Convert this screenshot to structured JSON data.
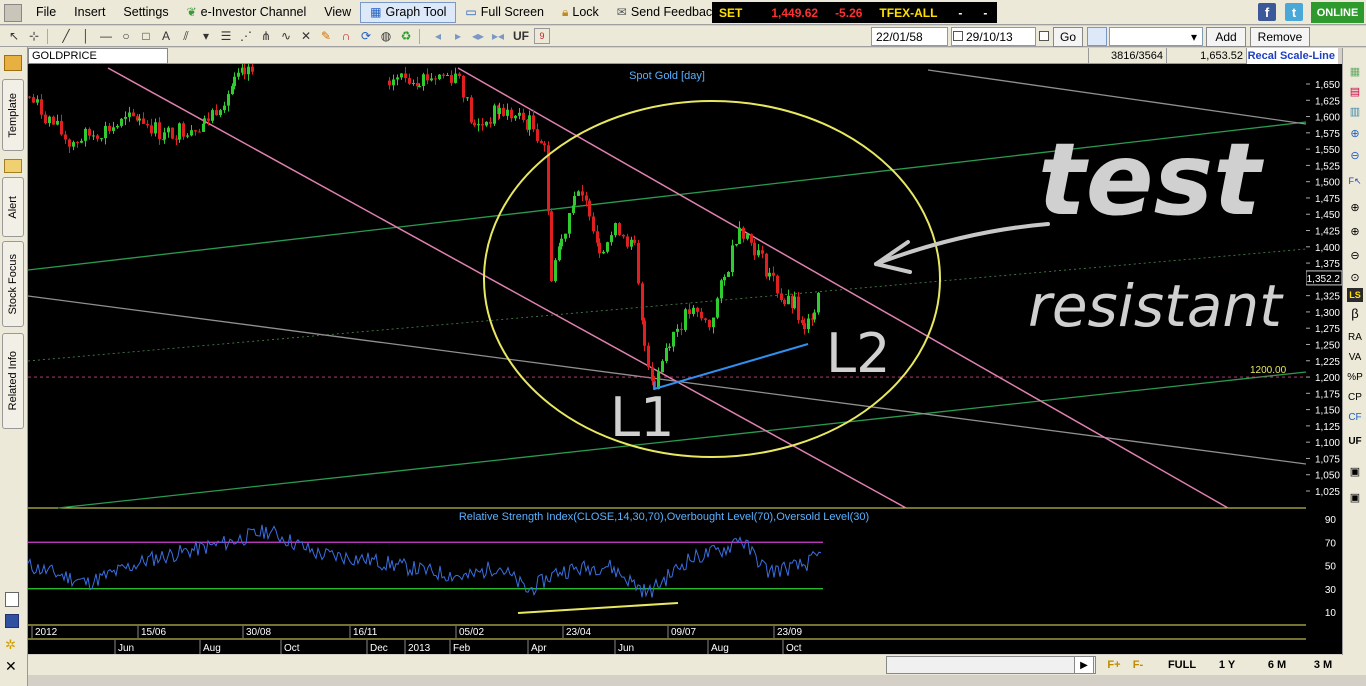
{
  "menu": {
    "items": [
      {
        "label": "File"
      },
      {
        "label": "Insert"
      },
      {
        "label": "Settings"
      },
      {
        "label": "e-Investor Channel",
        "icon": "leaf-icon"
      },
      {
        "label": "View"
      },
      {
        "label": "Graph Tool",
        "icon": "graph-icon"
      },
      {
        "label": "Full Screen",
        "icon": "fullscreen-icon"
      },
      {
        "label": "Lock",
        "icon": "lock-icon"
      },
      {
        "label": "Send Feedback",
        "icon": "feedback-icon"
      }
    ]
  },
  "ticker": {
    "set_label": "SET",
    "set_value": "1,449.62",
    "set_change": "-5.26",
    "tfex_label": "TFEX-ALL",
    "tfex_value": "-",
    "tfex_change": "-"
  },
  "status": {
    "online": "ONLINE"
  },
  "toolbar": {
    "uf_label": "UF",
    "cal_label": "9",
    "date_from": "22/01/58",
    "date_to": "29/10/13",
    "go_label": "Go",
    "add_label": "Add",
    "remove_label": "Remove"
  },
  "left_tabs": [
    "Template",
    "Alert",
    "Stock Focus",
    "Related Info"
  ],
  "symbol": "GOLDPRICE",
  "infobar": {
    "count": "3816/3564",
    "value": "1,653.52",
    "scale": "Recal Scale-Line"
  },
  "right_strip": [
    "LS",
    "β",
    "RA",
    "VA",
    "%P",
    "CP",
    "CF",
    "UF"
  ],
  "chart_data": {
    "type": "candlestick",
    "title": "Spot Gold [day]",
    "ylim": [
      1000,
      1665
    ],
    "yticks": [
      1650,
      1625,
      1600,
      1575,
      1550,
      1525,
      1500,
      1475,
      1450,
      1425,
      1400,
      1375,
      1350,
      1325,
      1300,
      1275,
      1250,
      1225,
      1200,
      1175,
      1150,
      1125,
      1100,
      1075,
      1050,
      1025
    ],
    "last_price": "1,352.2",
    "hline_label": "1200.00",
    "annotations": [
      "test",
      "resistant",
      "L1",
      "L2"
    ],
    "rsi": {
      "title": "Relative Strength Index(CLOSE,14,30,70),Overbought Level(70),Oversold Level(30)",
      "yticks": [
        90,
        70,
        50,
        30,
        10
      ],
      "overbought": 70,
      "oversold": 30
    },
    "dates_top": [
      "2012",
      "15/06",
      "30/08",
      "16/11",
      "05/02",
      "23/04",
      "09/07",
      "23/09"
    ],
    "dates_bottom": [
      "Jun",
      "Aug",
      "Oct",
      "Dec",
      "2013",
      "Feb",
      "Apr",
      "Jun",
      "Aug",
      "Oct"
    ]
  },
  "periods": [
    "F+",
    "F-",
    "FULL",
    "1 Y",
    "6 M",
    "3 M"
  ],
  "colors": {
    "up": "#2ecc2e",
    "down": "#e02020",
    "rsi": "#3a6fe0",
    "ellipse": "#e8e860",
    "pink": "#e080b0",
    "green": "#2a9a50",
    "gray": "#909090"
  }
}
